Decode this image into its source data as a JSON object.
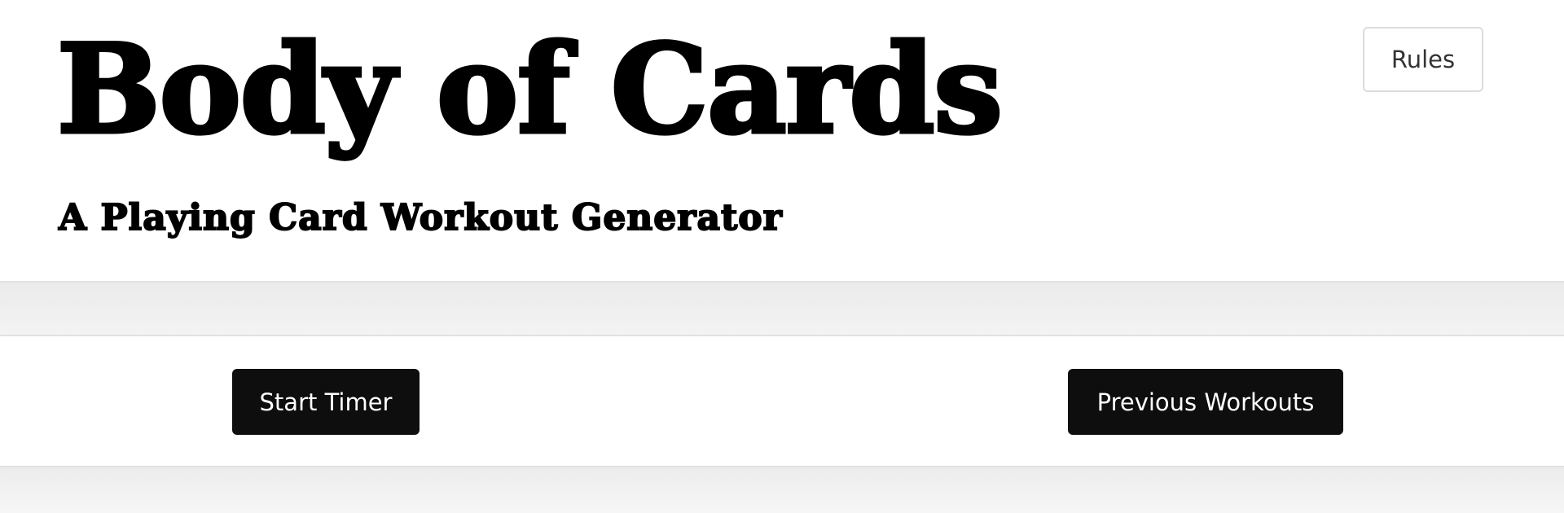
{
  "header": {
    "title": "Body of Cards",
    "subtitle": "A Playing Card Workout Generator",
    "rules_label": "Rules"
  },
  "toolbar": {
    "start_timer_label": "Start Timer",
    "previous_workouts_label": "Previous Workouts"
  },
  "colors": {
    "background": "#ffffff",
    "band": "#ededed",
    "button_dark": "#0e0e0e",
    "button_text": "#ffffff",
    "title_text": "#000000"
  }
}
